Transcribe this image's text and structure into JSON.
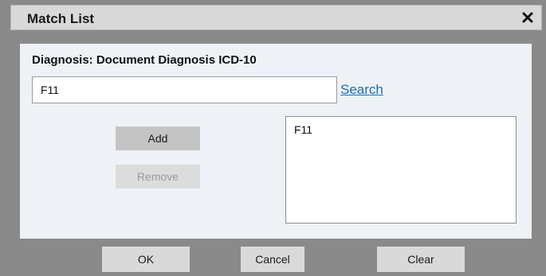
{
  "dialog": {
    "title": "Match List",
    "close_icon": "close-icon"
  },
  "diagnosis": {
    "label": "Diagnosis: Document Diagnosis ICD-10",
    "search_value": "F11",
    "search_link": "Search"
  },
  "actions": {
    "add_label": "Add",
    "remove_label": "Remove"
  },
  "match_list": {
    "items": [
      "F11"
    ]
  },
  "footer": {
    "ok_label": "OK",
    "cancel_label": "Cancel",
    "clear_label": "Clear"
  }
}
